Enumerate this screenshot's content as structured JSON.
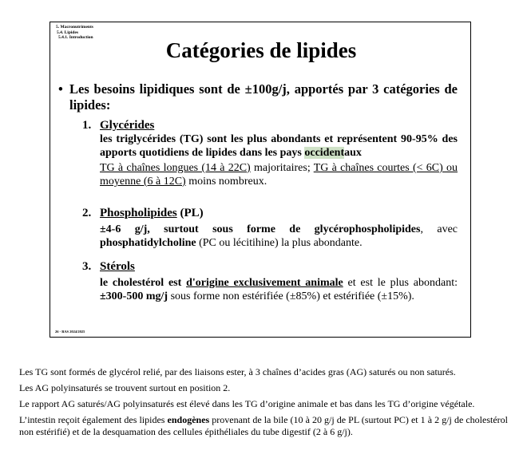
{
  "slide": {
    "breadcrumb": [
      "5. Macronutriments",
      "5.4. Lipides",
      "5.4.1. Introduction"
    ],
    "title": "Catégories de lipides",
    "intro": "Les besoins lipidiques sont de ±100g/j, apportés par 3 catégories de lipides:",
    "items": [
      {
        "num": "1.",
        "heading": "Glycérides",
        "line1_pre": "les triglycérides (TG) sont les plus abondants et représentent 90-95% des apports quotidiens de lipides dans les pays ",
        "line1_hl": "occident",
        "line1_post": "aux",
        "line2_a": "TG à chaînes longues (14 à 22C)",
        "line2_b": " majoritaires; ",
        "line2_c": "TG à chaînes courtes (< 6C) ou moyenne (6 à 12C)",
        "line2_d": " moins nombreux."
      },
      {
        "num": "2.",
        "heading": "Phospholipides",
        "heading_suffix": " (PL)",
        "text_bold": "±4-6 g/j, surtout sous forme de glycérophospholipides",
        "text_a": ", avec ",
        "text_bold2": "phosphatidylcholine",
        "text_b": " (PC ou lécitihine) la plus abondante."
      },
      {
        "num": "3.",
        "heading": "Stérols",
        "text_bold": "le cholestérol est ",
        "text_bold_u": "d'origine exclusivement animale",
        "text_a": " et est le plus abondant: ",
        "text_bold2": "±300-500 mg/j",
        "text_b": " sous forme non estérifiée (±85%) et estérifiée (±15%)."
      }
    ],
    "footer": "26 - BAS 2024/2025"
  },
  "notes": [
    {
      "text": "Les TG sont formés de glycérol relié, par des liaisons ester, à 3 chaînes d’acides gras (AG) saturés ou non saturés."
    },
    {
      "text": "Les AG polyinsaturés se trouvent surtout en position 2."
    },
    {
      "text": "Le rapport AG saturés/AG polyinsaturés est élevé dans les TG d’origine animale et bas dans les TG d’origine végétale."
    },
    {
      "pre": "L’intestin reçoit également des lipides ",
      "bold": "endogènes",
      "post": " provenant de la bile (10 à 20 g/j de PL (surtout PC) et 1 à 2 g/j de cholestérol non estérifié) et de la desquamation des cellules épithéliales du tube digestif (2 à 6 g/j)."
    }
  ]
}
